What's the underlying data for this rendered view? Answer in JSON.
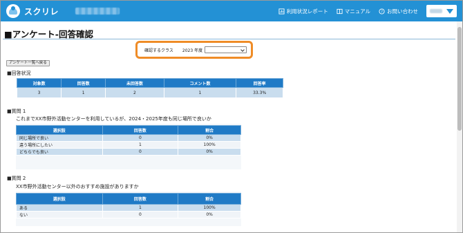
{
  "header": {
    "app_name": "スクリレ",
    "nav": [
      {
        "label": "利用状況レポート",
        "icon": "report-icon"
      },
      {
        "label": "マニュアル",
        "icon": "book-icon"
      },
      {
        "label": "お問い合わせ",
        "icon": "help-icon"
      }
    ],
    "brand_color": "#2391d5"
  },
  "page": {
    "title": "■アンケート-回答確認",
    "class_label": "確認するクラス",
    "year_label": "2023 年度",
    "class_select_value": "",
    "back_button": "アンケート一覧へ戻る",
    "highlight_color": "#ef8c27"
  },
  "status": {
    "heading": "■回答状況",
    "columns": [
      "対象数",
      "回答数",
      "未回答数",
      "コメント数",
      "回答率"
    ],
    "values": [
      "3",
      "1",
      "2",
      "1",
      "33.3%"
    ]
  },
  "questions": [
    {
      "heading": "■質問 1",
      "text": "これまでXX市野外活動センターを利用しているが、2024・2025年度も同じ場所で良いか",
      "columns": [
        "選択肢",
        "回答数",
        "割合"
      ],
      "rows": [
        [
          "同じ場所で良い",
          "0",
          "0%"
        ],
        [
          "違う場所にしたい",
          "1",
          "100%"
        ],
        [
          "どちらでも良い",
          "0",
          "0%"
        ]
      ]
    },
    {
      "heading": "■質問 2",
      "text": "XX市野外活動センター以外のおすすめ施設がありますか",
      "columns": [
        "選択肢",
        "回答数",
        "割合"
      ],
      "rows": [
        [
          "ある",
          "1",
          "100%"
        ],
        [
          "ない",
          "0",
          "0%"
        ]
      ]
    }
  ]
}
